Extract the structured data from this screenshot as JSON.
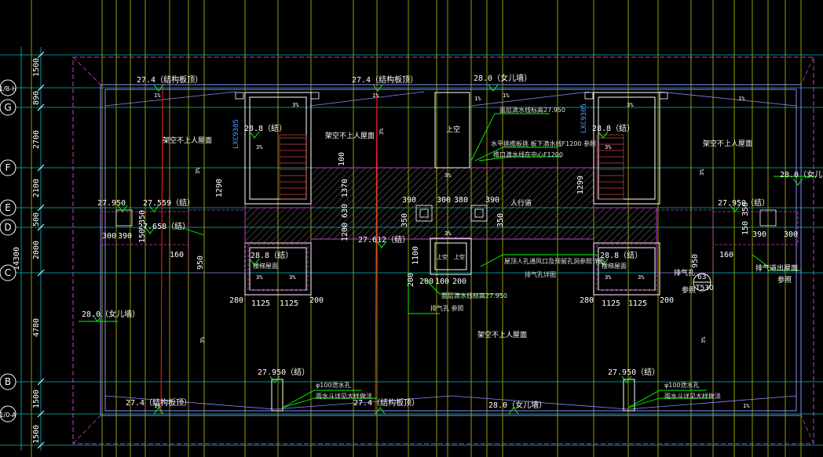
{
  "axes": {
    "bubbles": [
      "1/B-H",
      "G",
      "F",
      "E",
      "D",
      "C",
      "B",
      "1/0-A"
    ],
    "dims": [
      "1500",
      "890",
      "2700",
      "2100",
      "500",
      "2000",
      "4780",
      "1500",
      "1500"
    ],
    "overall_dim": "14300"
  },
  "elevations": {
    "top_left": "27.4（结构板顶）",
    "top_mid": "27.4（结构板顶）",
    "top_right": "28.0（女儿墙）",
    "bottom_left": "27.4（结构板顶）",
    "bottom_mid": "27.4（结构板顶）",
    "bottom_right": "28.0（女儿墙）",
    "stair_left": "28.8（结）",
    "stair_right": "28.8（结）",
    "box_left": "28.8（结）",
    "box_right": "28.8（结）",
    "e_left_a": "27.950",
    "e_left_b": "27.559（结）",
    "e_left_c": "27.658（结）",
    "e_right": "27.950（结）",
    "right_parapet": "28.0（女儿墙）",
    "left_parapet": "28.0（女儿墙）",
    "center": "27.612（结）",
    "bottom_a": "27.950（结）",
    "bottom_b": "27.950（结）"
  },
  "dims": {
    "d1290": "1290",
    "d1299": "1299",
    "d100": "100",
    "d1370": "1370",
    "d630": "630",
    "d1200": "1200",
    "d350": "350",
    "d390a": "390",
    "d300": "300",
    "d380": "380",
    "d390b": "390",
    "d350b": "350",
    "d1100": "1100",
    "d200a": "200",
    "d100b": "100",
    "d200b": "200",
    "d200c": "200",
    "d300l": "300",
    "d390l": "390",
    "d150_350": "150,350",
    "d160l": "160",
    "d950l": "950",
    "d200_l": "200",
    "d1125a": "1125",
    "d1125b": "1125",
    "d200_m": "200",
    "d280l": "280",
    "d280r": "280",
    "d1125c": "1125",
    "d1125d": "1125",
    "d200r": "200",
    "d950r": "950",
    "d160r": "160",
    "d150_350r": "150 350",
    "d390r": "390",
    "d300r": "300"
  },
  "notes": {
    "roof_left": "架空不上人屋面",
    "roof_mid": "架空不上人屋面",
    "roof_right": "架空不上人屋面",
    "roof_bottom": "架空不上人屋面",
    "void": "上空",
    "hatch": "人行道",
    "note_top1": "面层滴水线标高27.950",
    "note_top2": "水平挑檐板挑  板下滴水线F1200  参照",
    "note_top3": "檐口滴水线在中心F1200",
    "note_mid1": "屋顶人孔通风口及预留孔洞参照详图",
    "note_mid2": "排气孔详图",
    "note_bottom_a": "面层滴水线标高27.950",
    "note_bottom_b": "排气孔  参照",
    "note_right1": "排气孔",
    "note_right2": "参照",
    "exhaust": "排气道出屋面",
    "exhaust_ref": "参照",
    "ref_63": "63",
    "ref_t530": "T530",
    "bottom_note_a1": "φ100泄水孔",
    "bottom_note_a2": "雨水斗详见大样做法",
    "bottom_note_b1": "φ100泄水孔",
    "bottom_note_b2": "雨水斗详见大样做法",
    "lxc_left": "LXC9305",
    "lxc_right": "LXC9305",
    "door_a": "上空",
    "door_b": "上空"
  },
  "slopes": {
    "s1": "1%",
    "s2": "1%",
    "s3": "3%",
    "s4": "1%",
    "s5": "1%",
    "s6": "3%",
    "s7": "1%",
    "s8": "3%",
    "s9": "3%",
    "s10": "3%",
    "s11": "3%",
    "s12": "3%",
    "s13": "3%",
    "s14": "3%",
    "s15": "3%",
    "s16": "3%",
    "s17": "1%",
    "s18": "1%",
    "s19": "3%",
    "s20": "3%",
    "s21": "3%",
    "s22": "3%"
  },
  "colors": {
    "background": "#000000",
    "grid_cyan": "#00c8c8",
    "grid_yellow": "#e8e800",
    "text_white": "#ffffff",
    "green": "#00ff00",
    "magenta": "#c040c0",
    "red": "#ff2020",
    "violet": "#8080ff",
    "hatch": "#a0a0a0"
  }
}
